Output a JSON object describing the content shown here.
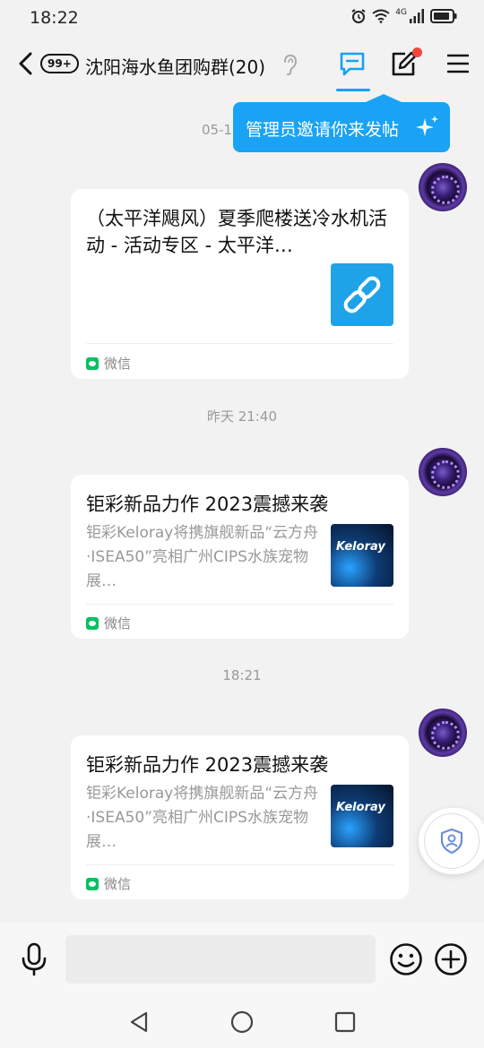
{
  "status": {
    "time": "18:22",
    "network": "4G"
  },
  "header": {
    "badge": "99+",
    "title": "沈阳海水鱼团购群(20)"
  },
  "tooltip": {
    "text": "管理员邀请你来发帖"
  },
  "chat": {
    "partial_timestamp": "05-1",
    "messages": [
      {
        "title": "（太平洋飓风）夏季爬楼送冷水机活动 - 活动专区 - 太平洋…",
        "description": "",
        "source": "微信",
        "thumb_icon": "link-icon"
      },
      {
        "timestamp": "昨天 21:40",
        "title": "钜彩新品力作 2023震撼来袭",
        "description": "钜彩Keloray将携旗舰新品“云方舟·ISEA50”亮相广州CIPS水族宠物展…",
        "source": "微信",
        "thumb_brand": "Keloray"
      },
      {
        "timestamp": "18:21",
        "title": "钜彩新品力作 2023震撼来袭",
        "description": "钜彩Keloray将携旗舰新品“云方舟·ISEA50”亮相广州CIPS水族宠物展…",
        "source": "微信",
        "thumb_brand": "Keloray"
      }
    ]
  },
  "input": {
    "placeholder": ""
  },
  "colors": {
    "accent": "#1aa3f5",
    "wechat": "#07c160",
    "badge_red": "#f2453d"
  }
}
